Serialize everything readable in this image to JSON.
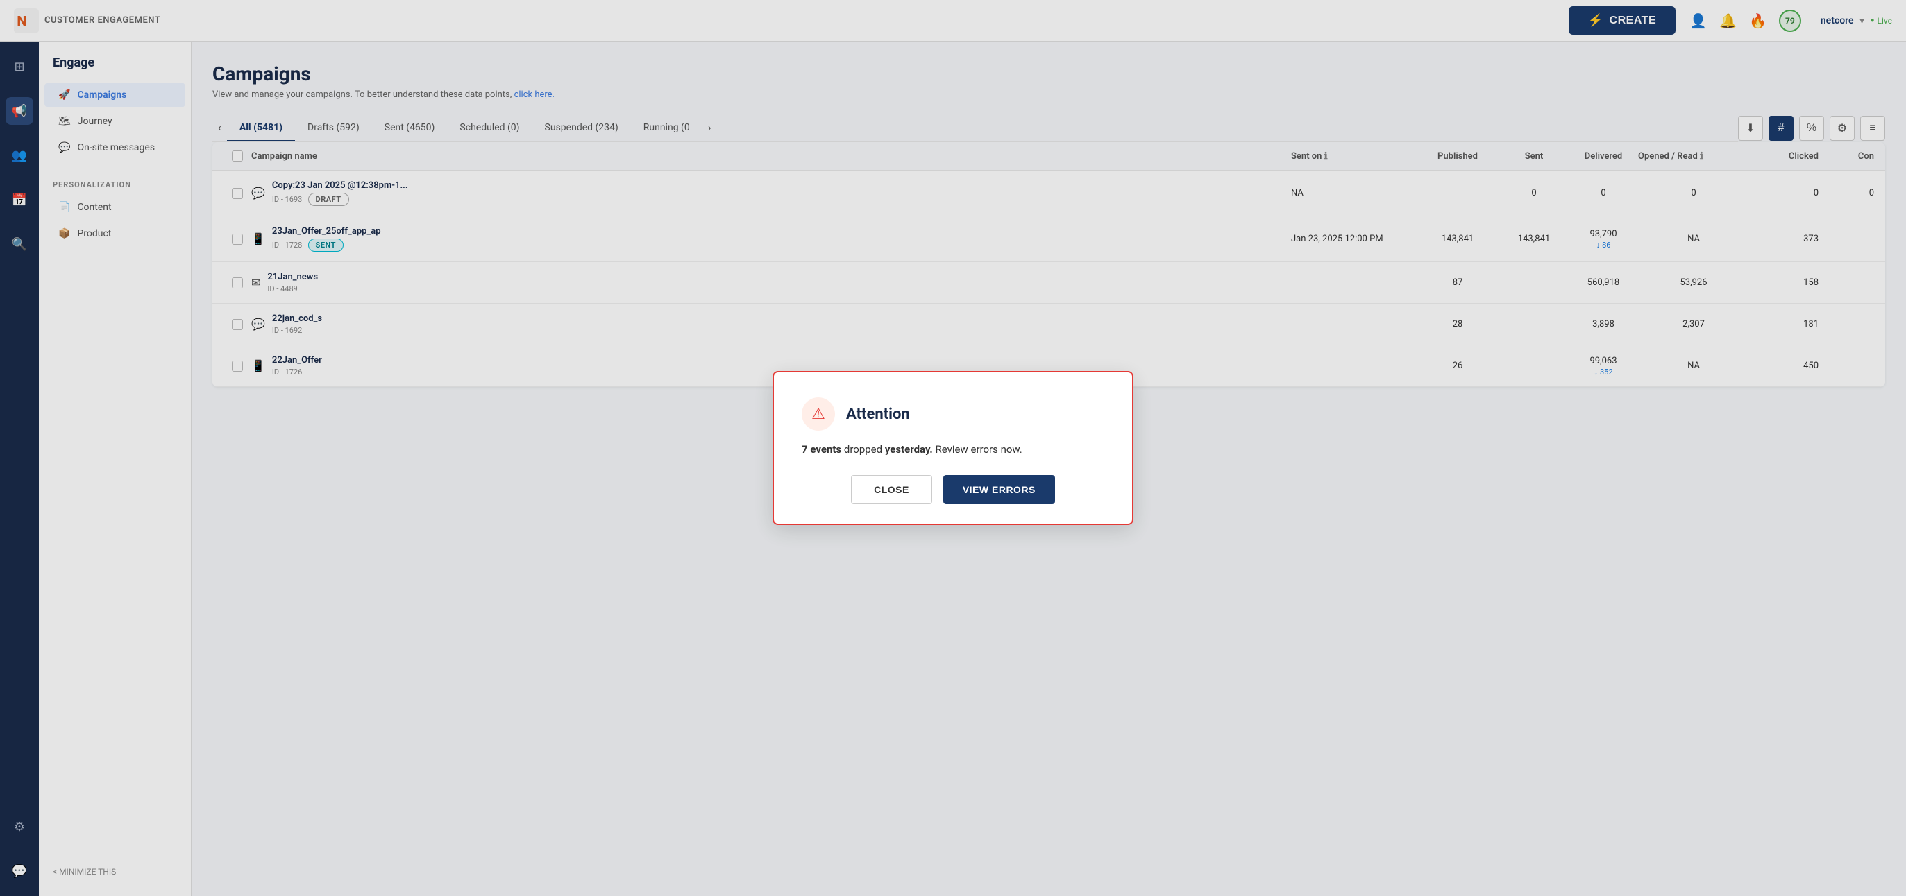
{
  "topnav": {
    "logo_text": "CUSTOMER ENGAGEMENT",
    "create_label": "CREATE",
    "score": "79",
    "user_name": "netcore",
    "status": "Live"
  },
  "icon_sidebar": {
    "items": [
      {
        "name": "grid-icon",
        "icon": "⊞",
        "active": false
      },
      {
        "name": "megaphone-icon",
        "icon": "📢",
        "active": true
      },
      {
        "name": "person-icon",
        "icon": "👤",
        "active": false
      },
      {
        "name": "calendar-icon",
        "icon": "📅",
        "active": false
      },
      {
        "name": "search-icon",
        "icon": "🔍",
        "active": false
      },
      {
        "name": "gear-icon",
        "icon": "⚙",
        "active": false
      },
      {
        "name": "chat-icon",
        "icon": "💬",
        "active": false
      }
    ]
  },
  "left_nav": {
    "title": "Engage",
    "items": [
      {
        "name": "campaigns",
        "label": "Campaigns",
        "active": true,
        "icon": "🚀"
      },
      {
        "name": "journey",
        "label": "Journey",
        "active": false,
        "icon": "🗺"
      },
      {
        "name": "on-site-messages",
        "label": "On-site messages",
        "active": false,
        "icon": "💬"
      }
    ],
    "personalization_section": "PERSONALIZATION",
    "personalization_items": [
      {
        "name": "content",
        "label": "Content",
        "active": false,
        "icon": "📄"
      },
      {
        "name": "product",
        "label": "Product",
        "active": false,
        "icon": "📦"
      }
    ],
    "minimize_label": "< MINIMIZE THIS"
  },
  "page": {
    "title": "Campaigns",
    "description": "View and manage your campaigns. To better understand these data points,",
    "link_text": "click here."
  },
  "tabs": [
    {
      "label": "All (5481)",
      "active": true
    },
    {
      "label": "Drafts (592)",
      "active": false
    },
    {
      "label": "Sent (4650)",
      "active": false
    },
    {
      "label": "Scheduled (0)",
      "active": false
    },
    {
      "label": "Suspended (234)",
      "active": false
    },
    {
      "label": "Running (0",
      "active": false
    }
  ],
  "table": {
    "columns": [
      "",
      "Campaign name",
      "Sent on",
      "Published",
      "Sent",
      "Delivered",
      "Opened / Read",
      "Clicked",
      "Con"
    ],
    "rows": [
      {
        "id": "row-1",
        "channel": "💬",
        "name": "Copy:23 Jan 2025 @12:38pm-1...",
        "campaign_id": "ID - 1693",
        "status": "DRAFT",
        "status_type": "draft",
        "sent_on": "NA",
        "published": "",
        "sent": "0",
        "delivered": "0",
        "opened": "0",
        "clicked": "0",
        "con": "0"
      },
      {
        "id": "row-2",
        "channel": "📱",
        "name": "23Jan_Offer_25off_app_ap",
        "campaign_id": "ID - 1728",
        "status": "SENT",
        "status_type": "sent",
        "sent_on": "Jan 23, 2025 12:00 PM",
        "published": "143,841",
        "sent": "143,841",
        "delivered": "93,790",
        "delivered_sub": "86",
        "opened": "NA",
        "clicked": "373",
        "con": ""
      },
      {
        "id": "row-3",
        "channel": "✉",
        "name": "21Jan_news",
        "campaign_id": "ID - 4489",
        "status": "",
        "status_type": "",
        "sent_on": "",
        "published": "87",
        "sent": "",
        "delivered": "560,918",
        "opened": "53,926",
        "clicked": "158",
        "con": ""
      },
      {
        "id": "row-4",
        "channel": "💬",
        "name": "22jan_cod_s",
        "campaign_id": "ID - 1692",
        "status": "",
        "status_type": "",
        "sent_on": "",
        "published": "28",
        "sent": "",
        "delivered": "3,898",
        "opened": "2,307",
        "clicked": "181",
        "con": ""
      },
      {
        "id": "row-5",
        "channel": "📱",
        "name": "22Jan_Offer",
        "campaign_id": "ID - 1726",
        "status": "",
        "status_type": "",
        "sent_on": "",
        "published": "26",
        "sent": "",
        "delivered": "99,063",
        "delivered_sub": "352",
        "opened": "NA",
        "clicked": "450",
        "con": ""
      }
    ]
  },
  "dialog": {
    "title": "Attention",
    "body_prefix": "7 events",
    "body_main": " dropped ",
    "body_emphasis": "yesterday.",
    "body_suffix": " Review errors now.",
    "close_label": "CLOSE",
    "view_errors_label": "VIEW ERRORS"
  }
}
